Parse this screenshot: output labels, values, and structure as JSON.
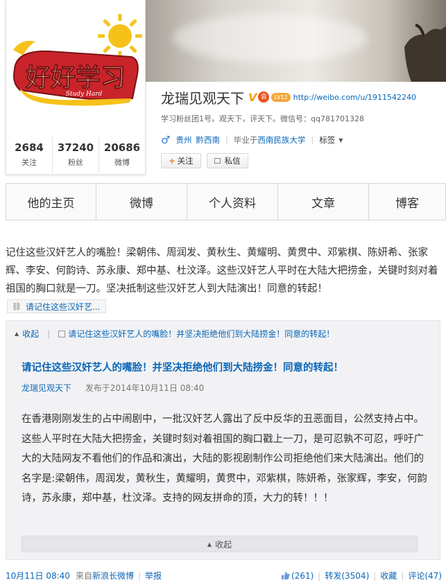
{
  "profile": {
    "name": "龙瑞见观天下",
    "v_badge": "V",
    "member_badge": "会",
    "level_badge": "LV12",
    "url": "http://weibo.com/u/1911542240",
    "bio": "学习粉丝团1号。观天下，评天下。微信号：qq781701328",
    "gender_symbol": "♂",
    "location_province": "贵州",
    "location_city": "黔西南",
    "education_prefix": "毕业于",
    "education_school": "西南民族大学",
    "tags_label": "标签",
    "follow_button": "关注",
    "message_button": "私信",
    "avatar_text": "好好学习",
    "avatar_subtext": "Study Hard"
  },
  "stats": [
    {
      "value": "2684",
      "label": "关注"
    },
    {
      "value": "37240",
      "label": "粉丝"
    },
    {
      "value": "20686",
      "label": "微博"
    }
  ],
  "tabs": [
    "他的主页",
    "微博",
    "个人资料",
    "文章",
    "博客"
  ],
  "post": {
    "text": "记住这些汉奸艺人的嘴脸！梁朝伟、周润发、黄秋生、黄耀明、黄贯中、邓紫棋、陈妍希、张家辉、李安、何韵诗、苏永康、郑中基、杜汶泽。这些汉奸艺人平时在大陆大把捞金，关键时刻对着祖国的胸口就是一刀。坚决抵制这些汉奸艺人到大陆演出！同意的转起！",
    "link_label": "请记住这些汉奸艺...",
    "expanded": {
      "collapse_label": "收起",
      "article_link": "请记住这些汉奸艺人的嘴脸！并坚决拒绝他们到大陆捞金！同意的转起！",
      "title": "请记住这些汉奸艺人的嘴脸！并坚决拒绝他们到大陆捞金！同意的转起！",
      "author": "龙瑞见观天下",
      "published": "发布于2014年10月11日 08:40",
      "body": "在香港刚刚发生的占中闹剧中，一批汉奸艺人露出了反中反华的丑恶面目，公然支持占中。这些人平时在大陆大把捞金，关键时刻对着祖国的胸口戳上一刀，是可忍孰不可忍，呼吁广大的大陆网友不看他们的作品和演出，大陆的影视剧制作公司拒绝他们来大陆演出。他们的名字是:梁朝伟，周润发，黄秋生，黄耀明，黄贯中，邓紫棋，陈妍希，张家辉，李安，何韵诗，苏永康，郑中基，杜汶泽。支持的网友拼命的顶，大力的转！！！",
      "bottom_collapse_label": "收起"
    },
    "footer": {
      "time": "10月11日 08:40",
      "from_prefix": "来自",
      "source": "新浪长微博",
      "report": "举报",
      "likes": "(261)",
      "repost": "转发(3504)",
      "favorite": "收藏",
      "comment": "评论(47)"
    }
  },
  "colors": {
    "link_blue": "#0a66b7",
    "vip_orange": "#f4a20a",
    "avatar_red": "#c8242a"
  }
}
